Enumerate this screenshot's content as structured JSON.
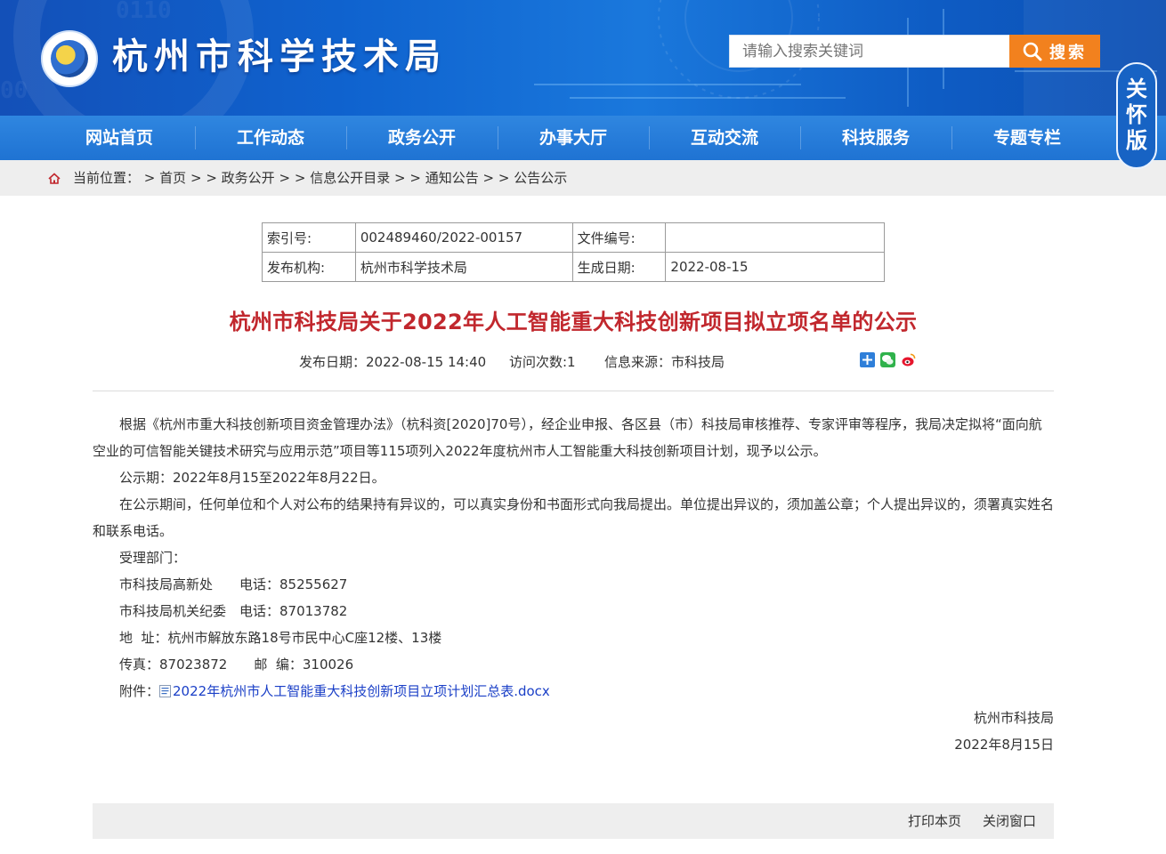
{
  "header": {
    "site_name": "杭州市科学技术局",
    "search_placeholder": "请输入搜索关键词",
    "search_button": "搜索",
    "care_mode": [
      "关",
      "怀",
      "版"
    ]
  },
  "nav": [
    "网站首页",
    "工作动态",
    "政务公开",
    "办事大厅",
    "互动交流",
    "科技服务",
    "专题专栏"
  ],
  "breadcrumb": {
    "prefix": "当前位置：",
    "items": [
      "首页",
      "政务公开",
      "信息公开目录",
      "通知公告",
      "公告公示"
    ],
    "separator": ">"
  },
  "info_table": {
    "index_label": "索引号:",
    "index_value": "002489460/2022-00157",
    "docno_label": "文件编号:",
    "docno_value": "",
    "org_label": "发布机构:",
    "org_value": "杭州市科学技术局",
    "date_label": "生成日期:",
    "date_value": "2022-08-15"
  },
  "article": {
    "title": "杭州市科技局关于2022年人工智能重大科技创新项目拟立项名单的公示",
    "meta": {
      "publish": "发布日期：2022-08-15 14:40",
      "visits": "访问次数:1",
      "source": "信息来源：市科技局"
    },
    "share_icons": [
      "share-plus-icon",
      "wechat-icon",
      "weibo-icon"
    ],
    "paragraphs": [
      "根据《杭州市重大科技创新项目资金管理办法》（杭科资[2020]70号），经企业申报、各区县（市）科技局审核推荐、专家评审等程序，我局决定拟将“面向航空业的可信智能关键技术研究与应用示范”项目等115项列入2022年度杭州市人工智能重大科技创新项目计划，现予以公示。",
      "公示期：2022年8月15至2022年8月22日。",
      "在公示期间，任何单位和个人对公布的结果持有异议的，可以真实身份和书面形式向我局提出。单位提出异议的，须加盖公章；个人提出异议的，须署真实姓名和联系电话。"
    ],
    "contacts": [
      "受理部门：",
      "市科技局高新处　　电话：85255627",
      "市科技局机关纪委　电话：87013782",
      "地  址：杭州市解放东路18号市民中心C座12楼、13楼",
      "传真：87023872　　邮  编：310026"
    ],
    "attachment_label": "附件：",
    "attachment_name": "2022年杭州市人工智能重大科技创新项目立项计划汇总表.docx",
    "signature": "杭州市科技局",
    "signature_date": "2022年8月15日"
  },
  "footer": {
    "print": "打印本页",
    "close": "关闭窗口"
  },
  "colors": {
    "banner": "#1463c8",
    "nav": "#2478d6",
    "search_button": "#f2811e",
    "title_red": "#c1272d",
    "link_blue": "#1a3fc7"
  }
}
